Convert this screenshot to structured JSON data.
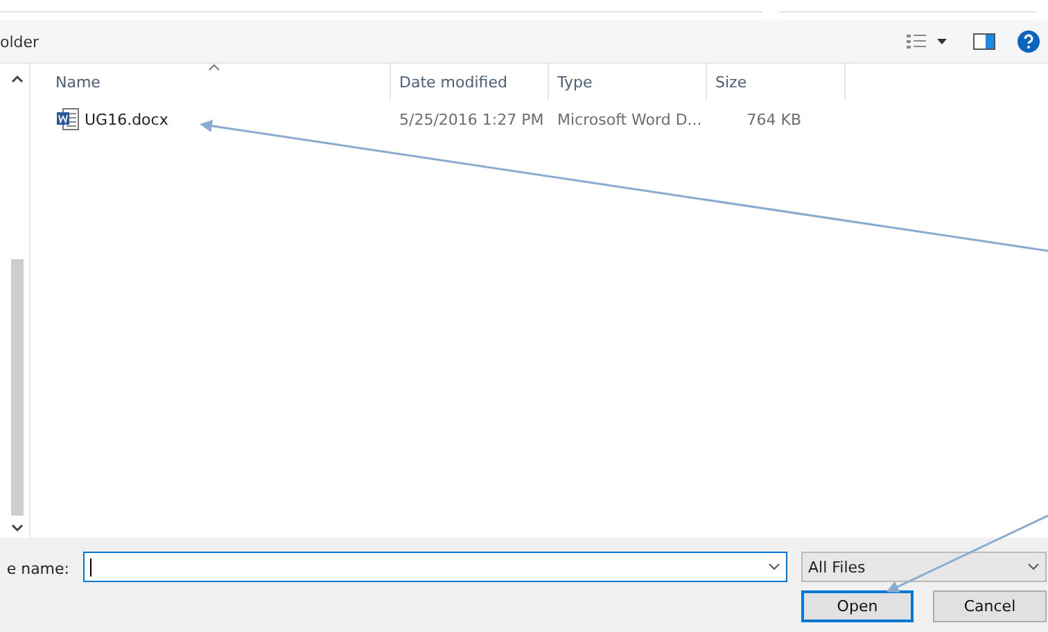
{
  "toolbar": {
    "location": "older"
  },
  "columns": [
    {
      "label": "Name",
      "sorted": true
    },
    {
      "label": "Date modified",
      "sorted": false
    },
    {
      "label": "Type",
      "sorted": false
    },
    {
      "label": "Size",
      "sorted": false
    }
  ],
  "rows": [
    {
      "name": "UG16.docx",
      "date": "5/25/2016 1:27 PM",
      "type": "Microsoft Word D...",
      "size": "764 KB"
    }
  ],
  "file_name": {
    "label": "e name:"
  },
  "file_type": {
    "value": "All Files"
  },
  "buttons": [
    {
      "label": "Open",
      "default": true
    },
    {
      "label": "Cancel",
      "default": false
    }
  ]
}
